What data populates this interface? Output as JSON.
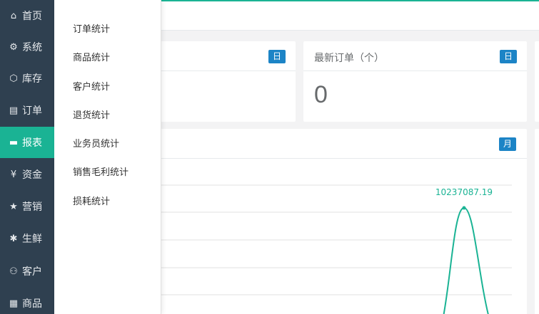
{
  "sidebar": {
    "items": [
      {
        "label": "首页",
        "icon": "home-icon",
        "glyph": "⌂"
      },
      {
        "label": "系统",
        "icon": "gear-icon",
        "glyph": "⚙"
      },
      {
        "label": "库存",
        "icon": "cube-icon",
        "glyph": "⬡"
      },
      {
        "label": "订单",
        "icon": "document-icon",
        "glyph": "▤"
      },
      {
        "label": "报表",
        "icon": "monitor-icon",
        "glyph": "▬"
      },
      {
        "label": "资金",
        "icon": "yen-icon",
        "glyph": "¥"
      },
      {
        "label": "营销",
        "icon": "star-icon",
        "glyph": "★"
      },
      {
        "label": "生鲜",
        "icon": "palm-icon",
        "glyph": "✱"
      },
      {
        "label": "客户",
        "icon": "user-icon",
        "glyph": "⚇"
      },
      {
        "label": "商品",
        "icon": "grid-icon",
        "glyph": "▦"
      }
    ],
    "active_index": 4,
    "active_color": "#1ab394"
  },
  "submenu": {
    "items": [
      "订单统计",
      "商品统计",
      "客户统计",
      "退货统计",
      "业务员统计",
      "销售毛利统计",
      "损耗统计"
    ]
  },
  "cards": {
    "left_badge": "日",
    "orders": {
      "title": "最新订单（个）",
      "badge": "日",
      "value": "0"
    },
    "chart_badge": "月"
  },
  "chart_data": {
    "type": "line",
    "peak_label": "10237087.19",
    "series": [
      {
        "values": [
          10237087.19
        ]
      }
    ],
    "color": "#1ab394"
  }
}
